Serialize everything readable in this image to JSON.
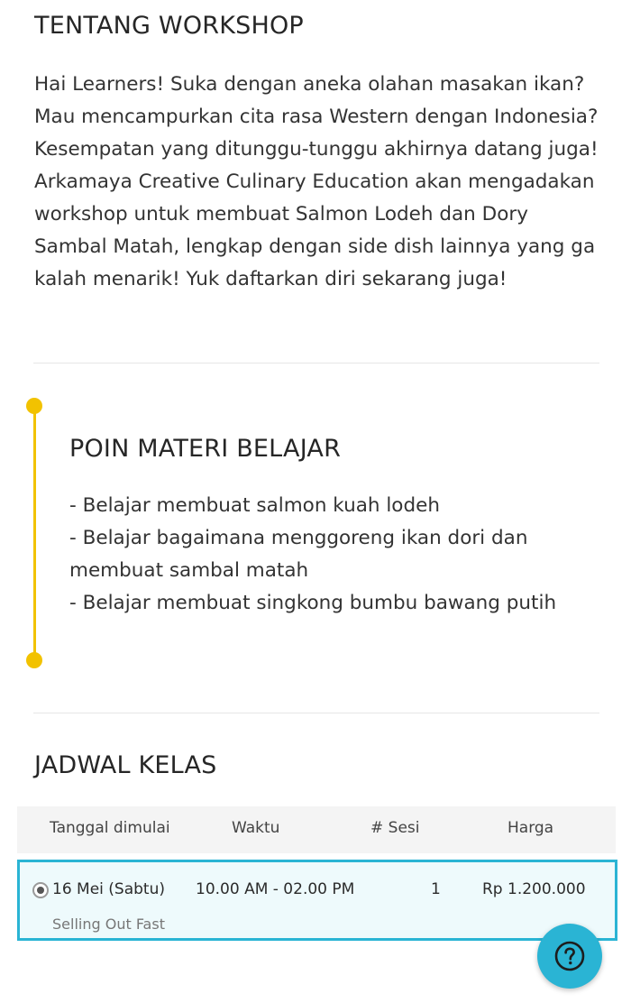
{
  "about": {
    "title": "TENTANG WORKSHOP",
    "text": "Hai Learners! Suka dengan aneka olahan masakan ikan? Mau mencampurkan cita rasa Western dengan Indonesia? Kesempatan yang ditunggu-tunggu akhirnya datang juga! Arkamaya Creative Culinary Education akan mengadakan workshop untuk membuat Salmon Lodeh dan Dory Sambal Matah, lengkap dengan side dish lainnya yang ga kalah menarik! Yuk daftarkan diri sekarang juga!"
  },
  "poin": {
    "title": "POIN MATERI BELAJAR",
    "items": [
      "- Belajar membuat salmon kuah lodeh",
      "- Belajar bagaimana menggoreng ikan dori dan membuat sambal matah",
      "- Belajar membuat singkong bumbu bawang putih"
    ]
  },
  "jadwal": {
    "title": "JADWAL KELAS",
    "headers": {
      "date": "Tanggal dimulai",
      "time": "Waktu",
      "sesi": "# Sesi",
      "price": "Harga"
    },
    "rows": [
      {
        "date": "16 Mei (Sabtu)",
        "time": "10.00 AM - 02.00 PM",
        "sesi": "1",
        "price": "Rp 1.200.000",
        "status": "Selling Out Fast",
        "selected": true
      }
    ]
  },
  "colors": {
    "accent": "#2ab4d4",
    "timeline": "#f2c200"
  },
  "icons": {
    "help": "question-circle-icon",
    "radio": "radio-selected-icon"
  }
}
